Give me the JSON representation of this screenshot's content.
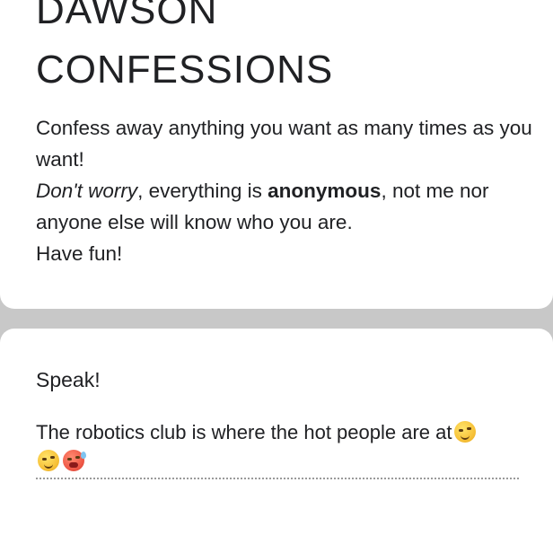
{
  "form": {
    "title_line1": "DAWSON",
    "title_line2": "CONFESSIONS",
    "description": {
      "line1": "Confess away anything you want as many times as you want!",
      "line2_italic": "Don't worry",
      "line2_mid": ", everything is ",
      "line2_bold": "anonymous",
      "line2_end": ", not me nor anyone else will know who you are.",
      "line3": "Have fun!"
    }
  },
  "question": {
    "label": "Speak!",
    "answer_text": "The robotics club is where the hot people are at",
    "emojis": [
      "woozy-face-emoji",
      "woozy-face-emoji",
      "hot-face-emoji"
    ]
  },
  "colors": {
    "background": "#c8c8c8",
    "card": "#ffffff",
    "text": "#202124"
  }
}
